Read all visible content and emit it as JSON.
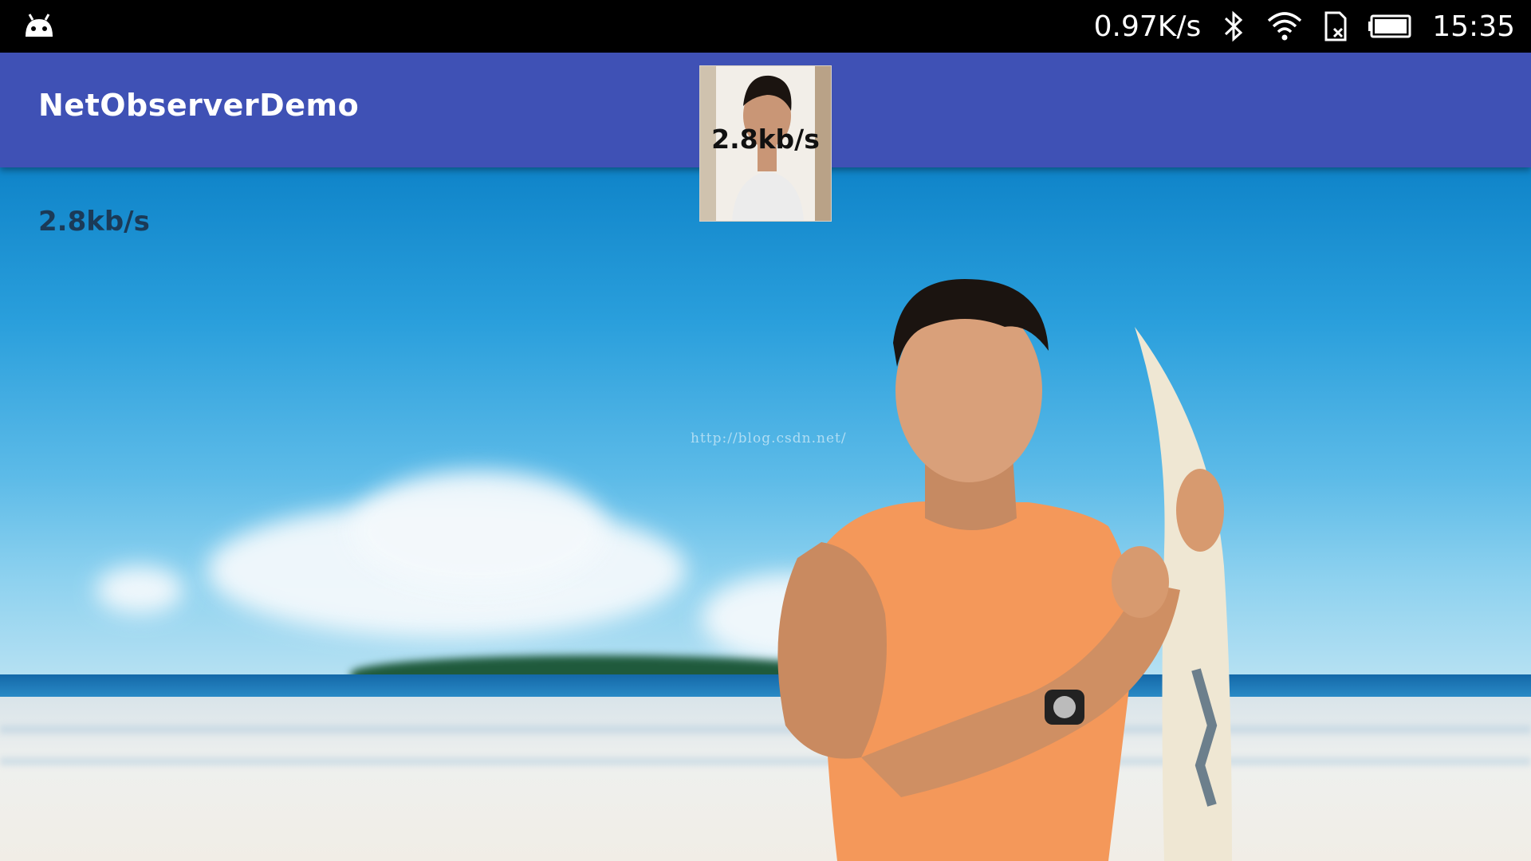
{
  "status_bar": {
    "net_speed": "0.97K/s",
    "time": "15:35",
    "icons": [
      "android-notification-icon",
      "bluetooth-icon",
      "wifi-icon",
      "sim-none-icon",
      "battery-icon"
    ]
  },
  "app_bar": {
    "title": "NetObserverDemo",
    "color": "#3f51b5"
  },
  "content": {
    "speed_label": "2.8kb/s",
    "watermark": "http://blog.csdn.net/"
  },
  "thumbnail": {
    "speed_text": "2.8kb/s"
  }
}
